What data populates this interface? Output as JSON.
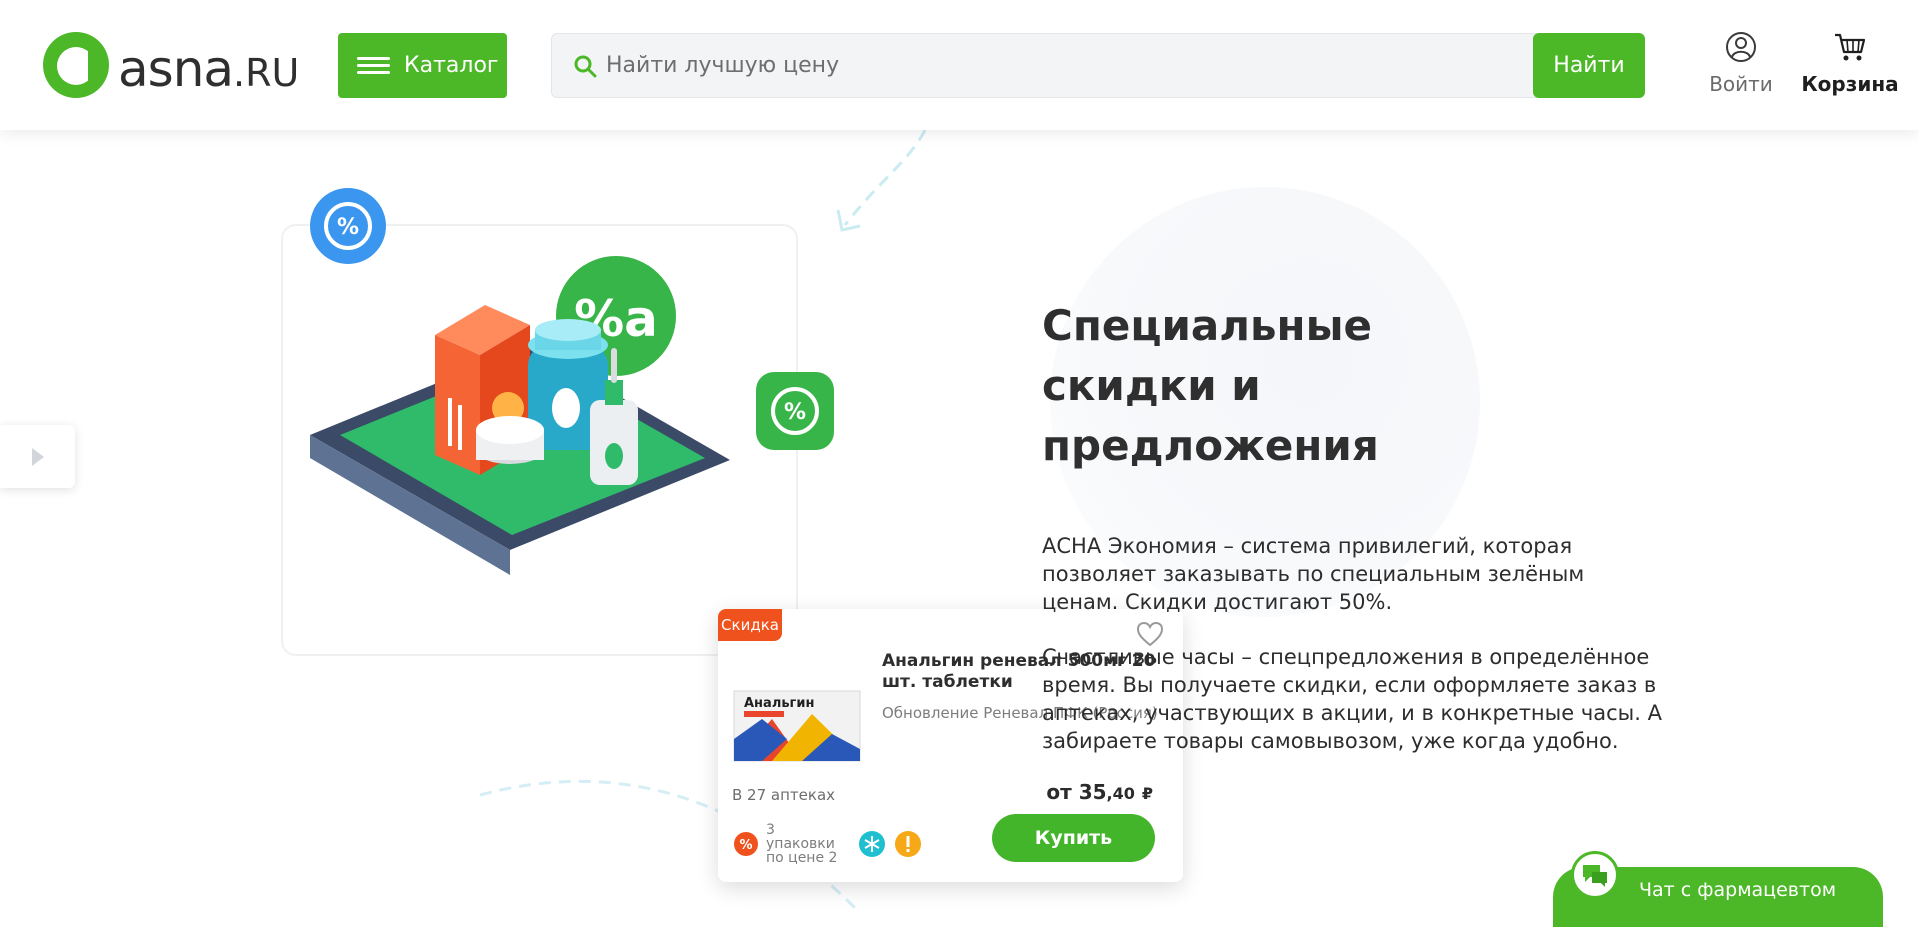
{
  "header": {
    "logo_main": "asna",
    "logo_suffix": ".RU",
    "catalog_label": "Каталог",
    "search_placeholder": "Найти лучшую цену",
    "search_button": "Найти",
    "login_label": "Войти",
    "cart_label": "Корзина",
    "accent_color": "#4cb828"
  },
  "illustration": {
    "product_card": {
      "badge": "Скидка",
      "name": "Анальгин реневал 500мг 20 шт. таблетки",
      "manufacturer": "Обновление Реневал ПФК (Россия)",
      "box_text": "Анальгин",
      "availability": "В 27 аптеках",
      "price_prefix": "от",
      "price_main": "35",
      "price_kop": ",40",
      "currency": "₽",
      "promo_text": "3 упаковки по цене 2",
      "buy_label": "Купить"
    }
  },
  "content": {
    "title": "Специальные скидки и предложения",
    "paragraph1": "АСНА Экономия – система привилегий, которая позволяет заказывать по специальным зелёным ценам. Скидки достигают 50%.",
    "paragraph2": "Счастливые часы – спецпредложения в определённое время. Вы получаете скидки, если оформляете заказ в аптеках, участвующих в акции, и в конкретные часы. А забираете товары самовывозом, уже когда удобно."
  },
  "chat": {
    "label": "Чат с фармацевтом"
  }
}
